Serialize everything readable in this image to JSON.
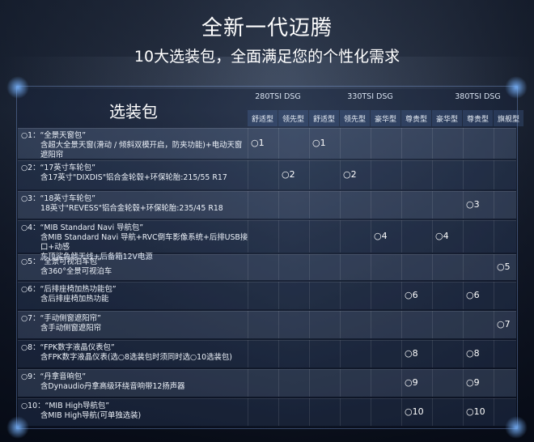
{
  "header": {
    "title": "全新一代迈腾",
    "subtitle": "10大选装包，全面满足您的个性化需求"
  },
  "table": {
    "options_header": "选装包",
    "engines": [
      {
        "label": "280TSI  DSG"
      },
      {
        "label": "330TSI  DSG"
      },
      {
        "label": "380TSI  DSG"
      }
    ],
    "trims": [
      "舒适型",
      "领先型",
      "舒适型",
      "领先型",
      "豪华型",
      "尊贵型",
      "豪华型",
      "尊贵型",
      "旗舰型"
    ],
    "rows": [
      {
        "line1": "○1：“全景天窗包”",
        "line2": "含超大全景天窗(滑动 / 倾斜双模开启，防夹功能)+电动天窗遮阳帘",
        "line3": "",
        "marks": [
          {
            "col": 0,
            "text": "○1"
          },
          {
            "col": 2,
            "text": "○1"
          }
        ]
      },
      {
        "line1": "○2：“17英寸车轮包”",
        "line2": "含17英寸\"DIXDIS\"铝合金轮毂+环保轮胎:215/55 R17",
        "line3": "",
        "marks": [
          {
            "col": 1,
            "text": "○2"
          },
          {
            "col": 3,
            "text": "○2"
          }
        ]
      },
      {
        "line1": "○3：“18英寸车轮包”",
        "line2": "18英寸\"REVESS\"铝合金轮毂+环保轮胎:235/45 R18",
        "line3": "",
        "marks": [
          {
            "col": 7,
            "text": "○3"
          }
        ]
      },
      {
        "line1": "○4：“MIB Standard Navi 导航包”",
        "line2": "含MIB Standard Navi 导航+RVC倒车影像系统+后排USB接口+动感",
        "line3": "车顶鲨鱼鳍天线+后备箱12V电源",
        "marks": [
          {
            "col": 4,
            "text": "○4"
          },
          {
            "col": 6,
            "text": "○4"
          }
        ]
      },
      {
        "line1": "○5：“全景可视泊车包”",
        "line2": "含360°全景可视泊车",
        "line3": "",
        "marks": [
          {
            "col": 8,
            "text": "○5"
          }
        ]
      },
      {
        "line1": "○6：“后排座椅加热功能包”",
        "line2": "含后排座椅加热功能",
        "line3": "",
        "marks": [
          {
            "col": 5,
            "text": "○6"
          },
          {
            "col": 7,
            "text": "○6"
          }
        ]
      },
      {
        "line1": "○7：“手动侧窗遮阳帘”",
        "line2": "含手动侧窗遮阳帘",
        "line3": "",
        "marks": [
          {
            "col": 8,
            "text": "○7"
          }
        ]
      },
      {
        "line1": "○8：“FPK数字液晶仪表包”",
        "line2": "含FPK数字液晶仪表(选○8选装包时须同时选○10选装包)",
        "line3": "",
        "marks": [
          {
            "col": 5,
            "text": "○8"
          },
          {
            "col": 7,
            "text": "○8"
          }
        ]
      },
      {
        "line1": "○9：“丹拿音响包”",
        "line2": "含Dynaudio丹拿高级环绕音响带12扬声器",
        "line3": "",
        "marks": [
          {
            "col": 5,
            "text": "○9"
          },
          {
            "col": 7,
            "text": "○9"
          }
        ]
      },
      {
        "line1": "○10：“MIB High导航包”",
        "line2": "含MIB High导航(可单独选装)",
        "line3": "",
        "marks": [
          {
            "col": 5,
            "text": "○10"
          },
          {
            "col": 7,
            "text": "○10"
          }
        ]
      }
    ]
  }
}
